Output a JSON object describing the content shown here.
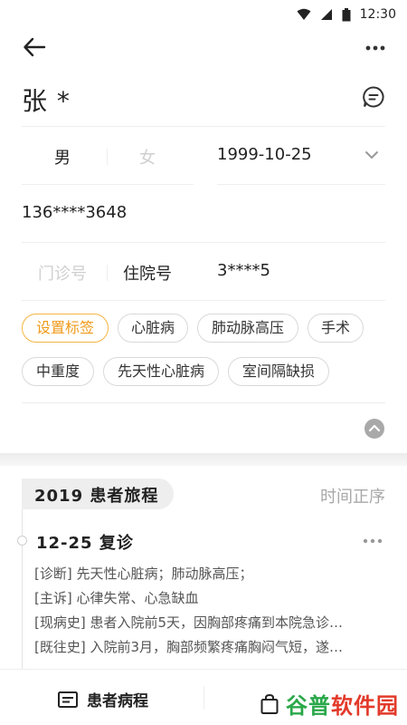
{
  "status_bar": {
    "time": "12:30"
  },
  "patient": {
    "name": "张 *",
    "gender_male": "男",
    "gender_female": "女",
    "birth_date": "1999-10-25",
    "phone": "136****3648",
    "id_type_outpatient": "门诊号",
    "id_type_inpatient": "住院号",
    "id_value": "3****5"
  },
  "tags": {
    "set_tags": "设置标签",
    "items": [
      "心脏病",
      "肺动脉高压",
      "手术",
      "中重度",
      "先天性心脏病",
      "室间隔缺损"
    ]
  },
  "journey": {
    "title": "2019  患者旅程",
    "order_toggle": "时间正序",
    "visit": {
      "title": "12-25  复诊",
      "lines": [
        "[诊断] 先天性心脏病；肺动脉高压；",
        "[主诉] 心律失常、心急缺血",
        "[现病史] 患者入院前5天，因胸部疼痛到本院急诊…",
        "[既往史] 入院前3月，胸部频繁疼痛胸闷气短，遂…"
      ]
    }
  },
  "bottom_bar": {
    "patient_records": "患者病程",
    "watermark": "谷普软件园"
  },
  "colors": {
    "accent": "#ef9a1a",
    "watermark_green": "#2aa84a",
    "watermark_red": "#e23a2a"
  },
  "icons": [
    "wifi-icon",
    "signal-icon",
    "battery-icon",
    "back-arrow-icon",
    "more-icon",
    "chat-icon",
    "chevron-down-icon",
    "collapse-up-icon",
    "document-icon",
    "bag-icon"
  ]
}
